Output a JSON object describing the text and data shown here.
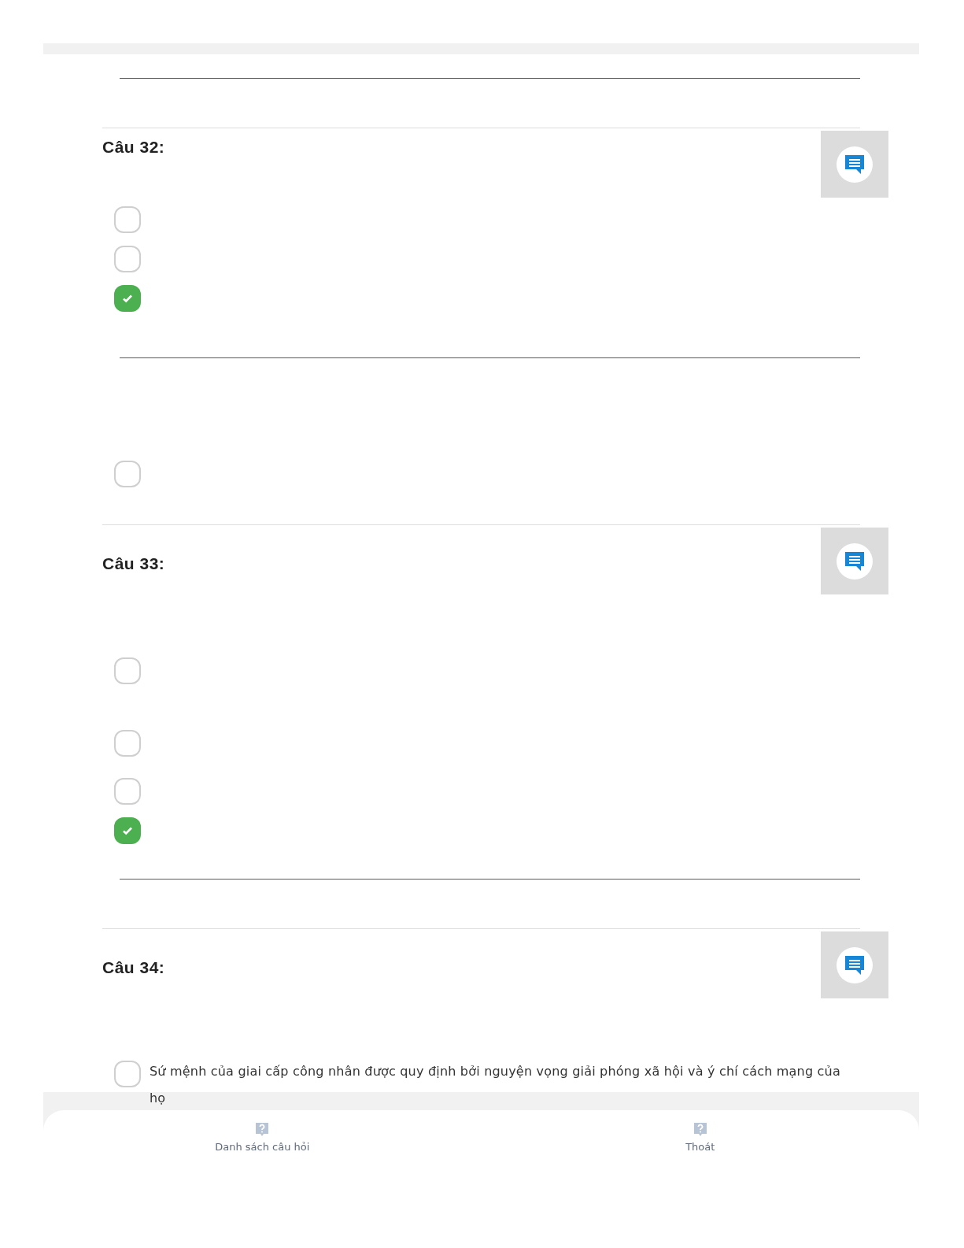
{
  "sections": [
    {
      "kind": "question",
      "title": "Câu 32:",
      "options": [
        {
          "checked": false
        },
        {
          "checked": false
        },
        {
          "checked": true
        }
      ]
    },
    {
      "kind": "continuation",
      "options": [
        {
          "checked": false
        }
      ]
    },
    {
      "kind": "question",
      "title": "Câu 33:",
      "options": [
        {
          "checked": false
        },
        {
          "checked": false
        },
        {
          "checked": false
        },
        {
          "checked": true
        }
      ]
    },
    {
      "kind": "question",
      "title": "Câu 34:",
      "options": [
        {
          "checked": false,
          "text": "Sứ mệnh của giai cấp công nhân được quy định bởi nguyện vọng giải phóng xã hội và ý chí cách mạng của họ"
        }
      ]
    }
  ],
  "footer": {
    "buttons": [
      {
        "label": "Danh sách câu hỏi"
      },
      {
        "label": "Thoát"
      }
    ]
  }
}
